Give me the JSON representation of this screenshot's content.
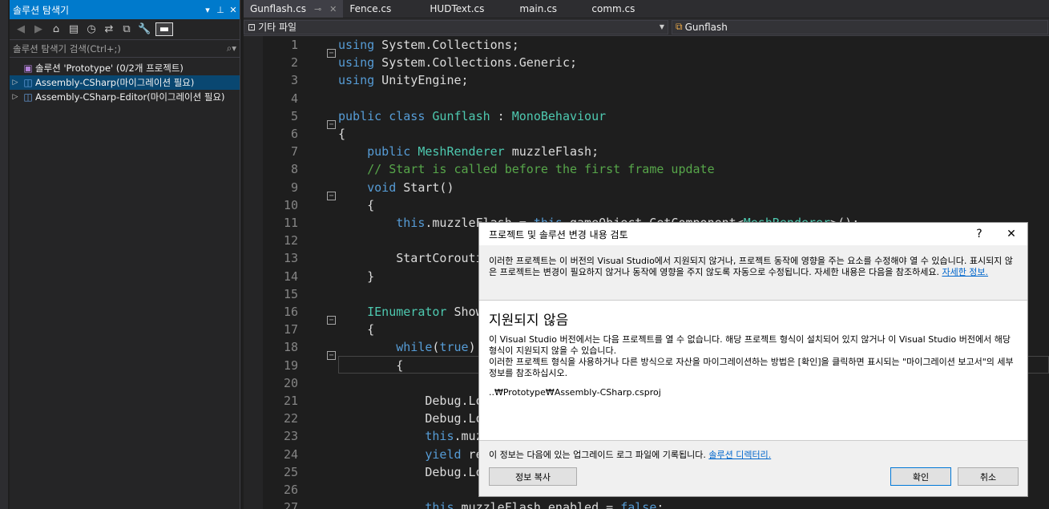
{
  "solution_explorer": {
    "title": "솔루션 탐색기",
    "search_placeholder": "솔루션 탐색기 검색(Ctrl+;)",
    "tree": [
      {
        "label": "솔루션 'Prototype' (0/2개 프로젝트)",
        "selected": false
      },
      {
        "label": "Assembly-CSharp(마이그레이션 필요)",
        "selected": true
      },
      {
        "label": "Assembly-CSharp-Editor(마이그레이션 필요)",
        "selected": false
      }
    ]
  },
  "tabs": [
    {
      "label": "Gunflash.cs",
      "active": true
    },
    {
      "label": "Fence.cs",
      "active": false
    },
    {
      "label": "HUDText.cs",
      "active": false
    },
    {
      "label": "main.cs",
      "active": false
    },
    {
      "label": "comm.cs",
      "active": false
    }
  ],
  "navbar": {
    "project": "기타 파일",
    "class": "Gunflash"
  },
  "code_lines": [
    {
      "n": "1",
      "text": "using System.Collections;"
    },
    {
      "n": "2",
      "text": "using System.Collections.Generic;"
    },
    {
      "n": "3",
      "text": "using UnityEngine;"
    },
    {
      "n": "4",
      "text": ""
    },
    {
      "n": "5",
      "text": "public class Gunflash : MonoBehaviour"
    },
    {
      "n": "6",
      "text": "{"
    },
    {
      "n": "7",
      "text": "    public MeshRenderer muzzleFlash;"
    },
    {
      "n": "8",
      "text": "    // Start is called before the first frame update"
    },
    {
      "n": "9",
      "text": "    void Start()"
    },
    {
      "n": "10",
      "text": "    {"
    },
    {
      "n": "11",
      "text": "        this.muzzleFlash = this.gameObject.GetComponent<MeshRenderer>();"
    },
    {
      "n": "12",
      "text": ""
    },
    {
      "n": "13",
      "text": "        StartCorouti"
    },
    {
      "n": "14",
      "text": "    }"
    },
    {
      "n": "15",
      "text": ""
    },
    {
      "n": "16",
      "text": "    IEnumerator ShowM"
    },
    {
      "n": "17",
      "text": "    {"
    },
    {
      "n": "18",
      "text": "        while(true)"
    },
    {
      "n": "19",
      "text": "        {"
    },
    {
      "n": "20",
      "text": ""
    },
    {
      "n": "21",
      "text": "            Debug.Log"
    },
    {
      "n": "22",
      "text": "            Debug.Log"
    },
    {
      "n": "23",
      "text": "            this.muzz"
    },
    {
      "n": "24",
      "text": "            yield ret"
    },
    {
      "n": "25",
      "text": "            Debug.Log"
    },
    {
      "n": "26",
      "text": ""
    },
    {
      "n": "27",
      "text": "            this.muzzleFlash.enabled = false;"
    }
  ],
  "dialog": {
    "title": "프로젝트 및 솔루션 변경 내용 검토",
    "help": "?",
    "close": "✕",
    "intro": "이러한 프로젝트는 이 버전의 Visual Studio에서 지원되지 않거나, 프로젝트 동작에 영향을 주는 요소를 수정해야 열 수 있습니다. 표시되지 않은 프로젝트는 변경이 필요하지 않거나 동작에 영향을 주지 않도록 자동으로 수정됩니다. 자세한 내용은 다음을 참조하세요.",
    "intro_link": "자세한 정보.",
    "heading": "지원되지 않음",
    "body1": "이 Visual Studio 버전에서는 다음 프로젝트를 열 수 없습니다. 해당 프로젝트 형식이 설치되어 있지 않거나 이 Visual Studio 버전에서 해당 형식이 지원되지 않을 수 있습니다.",
    "body2": "이러한 프로젝트 형식을 사용하거나 다른 방식으로 자산을 마이그레이션하는 방법은 [확인]을 클릭하면 표시되는 \"마이그레이션 보고서\"의 세부 정보를 참조하십시오.",
    "path": "..₩Prototype₩Assembly-CSharp.csproj",
    "footer": "이 정보는 다음에 있는 업그레이드 로그 파일에 기록됩니다.",
    "footer_link": "솔루션 디렉터리.",
    "copy_button": "정보 복사",
    "ok_button": "확인",
    "cancel_button": "취소"
  }
}
